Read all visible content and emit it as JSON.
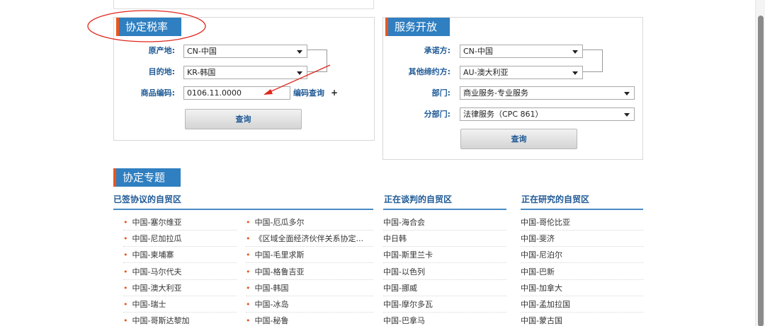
{
  "tariff": {
    "title": "协定税率",
    "origin_label": "原产地:",
    "origin_value": "CN-中国",
    "dest_label": "目的地:",
    "dest_value": "KR-韩国",
    "code_label": "商品编码:",
    "code_value": "0106.11.0000",
    "code_query": "编码查询",
    "plus": "+",
    "query_button": "查询"
  },
  "services": {
    "title": "服务开放",
    "promisor_label": "承诺方:",
    "promisor_value": "CN-中国",
    "other_label": "其他缔约方:",
    "other_value": "AU-澳大利亚",
    "dept_label": "部门:",
    "dept_value": "商业服务-专业服务",
    "subdept_label": "分部门:",
    "subdept_value": "法律服务（CPC 861）",
    "query_button": "查询"
  },
  "topics": {
    "title": "协定专题",
    "signed": {
      "heading": "已签协议的自贸区",
      "col1": [
        "中国-塞尔维亚",
        "中国-尼加拉瓜",
        "中国-柬埔寨",
        "中国-马尔代夫",
        "中国-澳大利亚",
        "中国-瑞士",
        "中国-哥斯达黎加"
      ],
      "col2": [
        "中国-厄瓜多尔",
        "《区域全面经济伙伴关系协定...",
        "中国-毛里求斯",
        "中国-格鲁吉亚",
        "中国-韩国",
        "中国-冰岛",
        "中国-秘鲁"
      ]
    },
    "negotiating": {
      "heading": "正在谈判的自贸区",
      "items": [
        "中国-海合会",
        "中日韩",
        "中国-斯里兰卡",
        "中国-以色列",
        "中国-挪威",
        "中国-摩尔多瓦",
        "中国-巴拿马"
      ]
    },
    "researching": {
      "heading": "正在研究的自贸区",
      "items": [
        "中国-哥伦比亚",
        "中国-斐济",
        "中国-尼泊尔",
        "中国-巴新",
        "中国-加拿大",
        "中国-孟加拉国",
        "中国-蒙古国"
      ]
    }
  },
  "colors": {
    "accent_blue": "#2f7fc1",
    "accent_orange": "#e8561e",
    "annotation_red": "#e0261c"
  }
}
